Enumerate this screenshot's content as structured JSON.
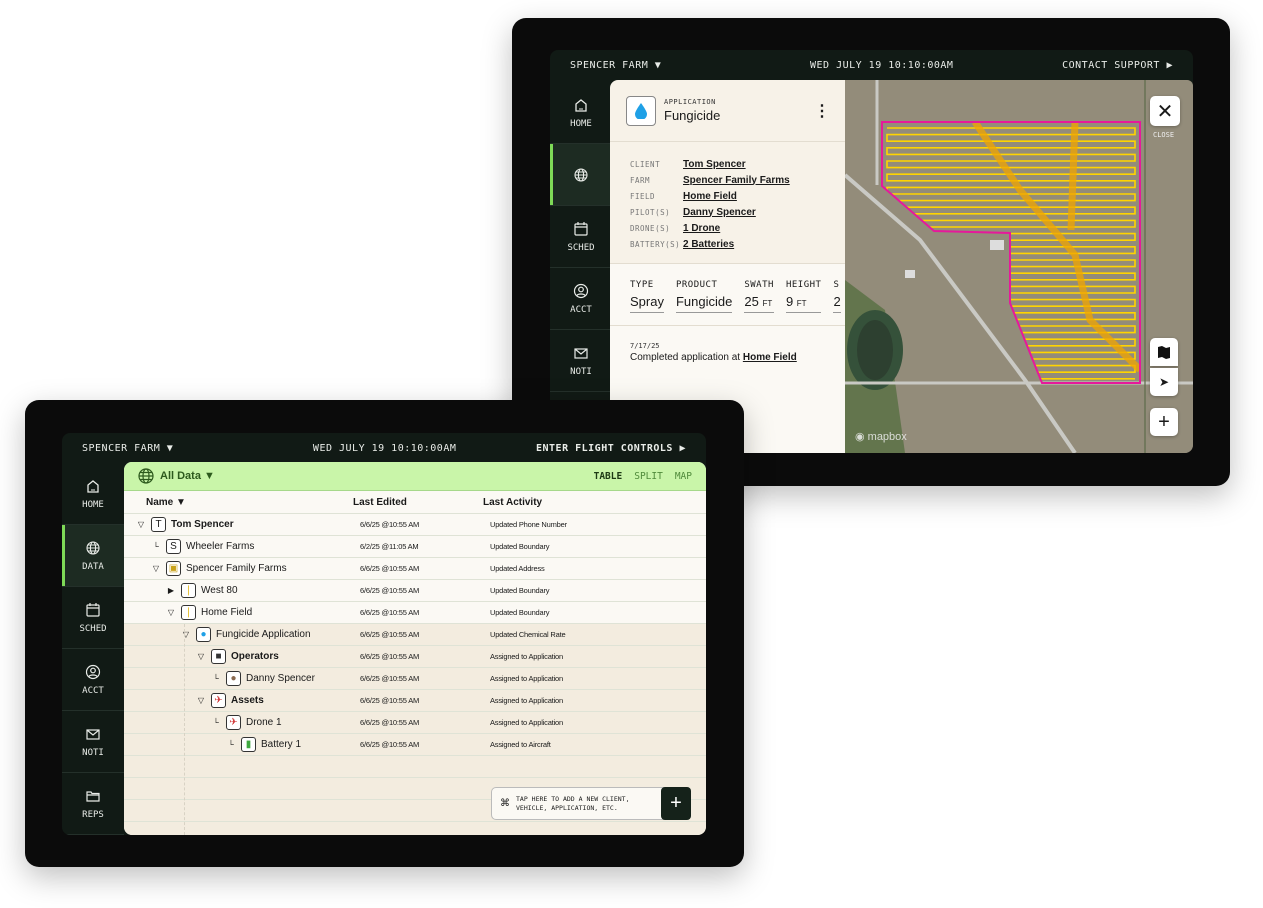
{
  "back_tablet": {
    "topbar": {
      "farm": "SPENCER FARM ▼",
      "datetime": "WED JULY 19 10:10:00AM",
      "support": "CONTACT SUPPORT ▶"
    },
    "sidebar": [
      {
        "label": "HOME",
        "icon": "home-icon"
      },
      {
        "label": "",
        "icon": "globe-icon",
        "active": true
      },
      {
        "label": "SCHED",
        "icon": "calendar-icon"
      },
      {
        "label": "ACCT",
        "icon": "account-icon"
      },
      {
        "label": "NOTI",
        "icon": "mail-icon"
      }
    ],
    "detail": {
      "kind": "APPLICATION",
      "title": "Fungicide",
      "icon": "droplet-icon",
      "fields": [
        {
          "label": "CLIENT",
          "value": "Tom Spencer"
        },
        {
          "label": "FARM",
          "value": "Spencer Family Farms"
        },
        {
          "label": "FIELD",
          "value": "Home Field"
        },
        {
          "label": "PILOT(S)",
          "value": "Danny Spencer"
        },
        {
          "label": "DRONE(S)",
          "value": "1 Drone"
        },
        {
          "label": "BATTERY(S)",
          "value": "2 Batteries"
        }
      ],
      "stats": [
        {
          "label": "TYPE",
          "value": "Spray",
          "unit": ""
        },
        {
          "label": "PRODUCT",
          "value": "Fungicide",
          "unit": ""
        },
        {
          "label": "SWATH",
          "value": "25",
          "unit": "FT"
        },
        {
          "label": "HEIGHT",
          "value": "9",
          "unit": "FT"
        },
        {
          "label": "S",
          "value": "2",
          "unit": ""
        }
      ],
      "activity": {
        "date": "7/17/25",
        "text": "Completed application at ",
        "link": "Home Field"
      }
    },
    "map": {
      "close_label": "CLOSE",
      "attribution": "mapbox",
      "boundary_color": "#e6199b",
      "path_color": "#ffd400"
    }
  },
  "front_tablet": {
    "topbar": {
      "farm": "SPENCER FARM ▼",
      "datetime": "WED JULY 19 10:10:00AM",
      "flight": "ENTER FLIGHT CONTROLS ▶"
    },
    "sidebar": [
      {
        "label": "HOME",
        "icon": "home-icon"
      },
      {
        "label": "DATA",
        "icon": "globe-icon",
        "active": true
      },
      {
        "label": "SCHED",
        "icon": "calendar-icon"
      },
      {
        "label": "ACCT",
        "icon": "account-icon"
      },
      {
        "label": "NOTI",
        "icon": "mail-icon"
      },
      {
        "label": "REPS",
        "icon": "folder-icon"
      }
    ],
    "header": {
      "scope": "All Data ▼",
      "views": [
        "TABLE",
        "SPLIT",
        "MAP"
      ],
      "active_view": "TABLE",
      "accent": "#c9f5a9"
    },
    "columns": {
      "name": "Name ▼",
      "edited": "Last Edited",
      "activity": "Last Activity"
    },
    "rows": [
      {
        "name": "Tom Spencer",
        "level": 0,
        "icon": "T",
        "toggle": "open",
        "bold": true,
        "edited": "6/6/25 @10:55 AM",
        "activity": "Updated Phone Number"
      },
      {
        "name": "Wheeler  Farms",
        "level": 1,
        "icon": "S",
        "toggle": "none",
        "edited": "6/2/25 @11:05 AM",
        "activity": "Updated Boundary"
      },
      {
        "name": "Spencer Family Farms",
        "level": 1,
        "icon": "tractor-icon",
        "toggle": "open",
        "edited": "6/6/25 @10:55 AM",
        "activity": "Updated Address"
      },
      {
        "name": "West 80",
        "level": 2,
        "icon": "corn-icon",
        "toggle": "closed",
        "edited": "6/6/25 @10:55 AM",
        "activity": "Updated Boundary"
      },
      {
        "name": "Home Field",
        "level": 2,
        "icon": "corn-icon",
        "toggle": "open",
        "edited": "6/6/25 @10:55 AM",
        "activity": "Updated Boundary"
      },
      {
        "name": "Fungicide Application",
        "level": 3,
        "icon": "droplet-icon",
        "toggle": "open",
        "edited": "6/6/25 @10:55 AM",
        "activity": "Updated Chemical Rate"
      },
      {
        "name": "Operators",
        "level": 4,
        "icon": "gamepad-icon",
        "toggle": "open",
        "bold": true,
        "edited": "6/6/25 @10:55 AM",
        "activity": "Assigned to Application"
      },
      {
        "name": "Danny Spencer",
        "level": 5,
        "icon": "avatar-icon",
        "toggle": "none",
        "edited": "6/6/25 @10:55 AM",
        "activity": "Assigned to Application"
      },
      {
        "name": "Assets",
        "level": 4,
        "icon": "drone-icon",
        "toggle": "open",
        "bold": true,
        "edited": "6/6/25 @10:55 AM",
        "activity": "Assigned to Application"
      },
      {
        "name": "Drone 1",
        "level": 5,
        "icon": "drone-icon",
        "toggle": "none",
        "edited": "6/6/25 @10:55 AM",
        "activity": "Assigned to Application"
      },
      {
        "name": "Battery 1",
        "level": 6,
        "icon": "battery-icon",
        "toggle": "none",
        "edited": "6/6/25 @10:55 AM",
        "activity": "Assigned to Aircraft"
      }
    ],
    "add_hint": "TAP HERE TO ADD A NEW CLIENT, VEHICLE, APPLICATION, ETC.",
    "add_button": "+"
  }
}
